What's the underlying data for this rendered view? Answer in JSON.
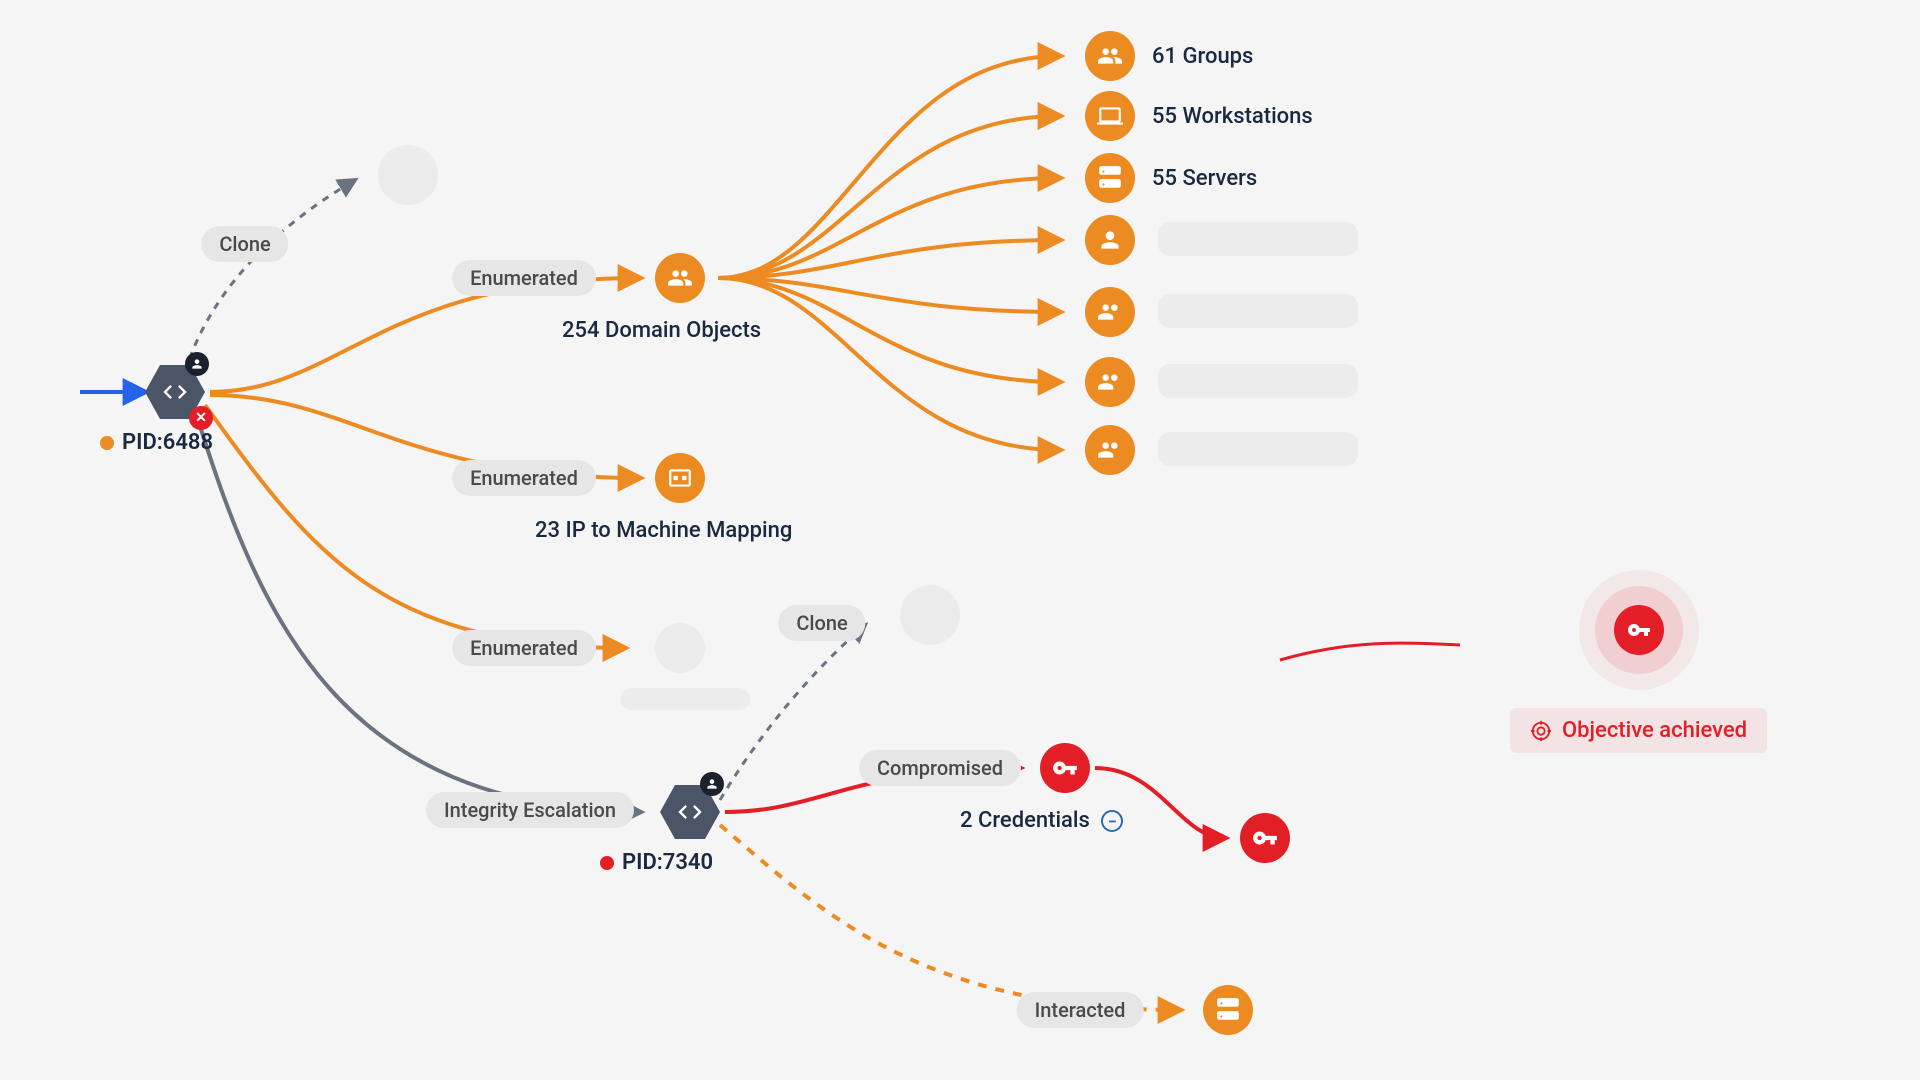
{
  "processes": {
    "p1": {
      "pid_label": "PID:6488",
      "status": "warning"
    },
    "p2": {
      "pid_label": "PID:7340",
      "status": "critical"
    }
  },
  "edges": {
    "clone_1": "Clone",
    "enumerated_1": "Enumerated",
    "enumerated_2": "Enumerated",
    "enumerated_3": "Enumerated",
    "integrity_escalation": "Integrity Escalation",
    "clone_2": "Clone",
    "compromised": "Compromised",
    "interacted": "Interacted"
  },
  "domain_objects": {
    "label": "254 Domain Objects",
    "children": [
      {
        "id": "groups",
        "label": "61 Groups",
        "icon": "users"
      },
      {
        "id": "workstations",
        "label": "55 Workstations",
        "icon": "laptop"
      },
      {
        "id": "servers",
        "label": "55 Servers",
        "icon": "server"
      },
      {
        "id": "obj4",
        "label": "",
        "icon": "user"
      },
      {
        "id": "obj5",
        "label": "",
        "icon": "users"
      },
      {
        "id": "obj6",
        "label": "",
        "icon": "users"
      },
      {
        "id": "obj7",
        "label": "",
        "icon": "users"
      }
    ]
  },
  "ip_mapping": {
    "label": "23 IP to Machine Mapping"
  },
  "credentials": {
    "label": "2 Credentials"
  },
  "objective": {
    "label": "Objective achieved"
  },
  "colors": {
    "orange": "#ed8b23",
    "red": "#e31e26",
    "grey": "#6b7280",
    "dark": "#4a5568",
    "blue": "#2563eb"
  }
}
